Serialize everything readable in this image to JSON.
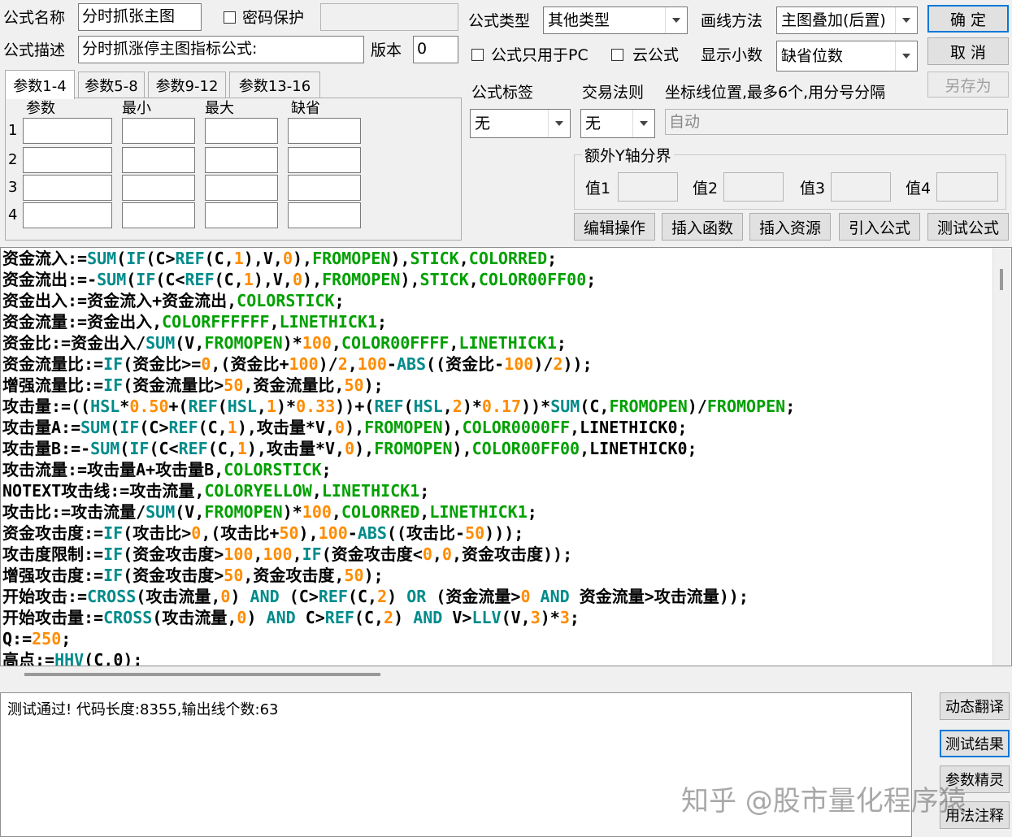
{
  "form": {
    "name_label": "公式名称",
    "name_value": "分时抓张主图",
    "password_label": "密码保护",
    "password_checked": false,
    "desc_label": "公式描述",
    "desc_value": "分时抓涨停主图指标公式:",
    "version_label": "版本",
    "version_value": "0",
    "type_label": "公式类型",
    "type_value": "其他类型",
    "draw_label": "画线方法",
    "draw_value": "主图叠加(后置)",
    "pc_only_label": "公式只用于PC",
    "pc_only_checked": false,
    "cloud_label": "云公式",
    "cloud_checked": false,
    "decimals_label": "显示小数",
    "decimals_value": "缺省位数",
    "tag_label": "公式标签",
    "tag_value": "无",
    "trade_label": "交易法则",
    "trade_value": "无",
    "axis_label": "坐标线位置,最多6个,用分号分隔",
    "axis_value": "自动",
    "yaxis_group_label": "额外Y轴分界",
    "yaxis_values": [
      "值1",
      "值2",
      "值3",
      "值4"
    ]
  },
  "buttons": {
    "ok": "确  定",
    "cancel": "取  消",
    "save_as": "另存为",
    "edit_ops": "编辑操作",
    "insert_func": "插入函数",
    "insert_res": "插入资源",
    "import_formula": "引入公式",
    "test_formula": "测试公式",
    "dyn_translate": "动态翻译",
    "test_result": "测试结果",
    "param_wizard": "参数精灵",
    "usage_notes": "用法注释"
  },
  "param_tabs": [
    "参数1-4",
    "参数5-8",
    "参数9-12",
    "参数13-16"
  ],
  "param_headers": [
    "参数",
    "最小",
    "最大",
    "缺省"
  ],
  "param_rows": [
    "1",
    "2",
    "3",
    "4"
  ],
  "colors": {
    "keyword": "#008b8b",
    "number": "#ff8c00",
    "color_const": "#00a000",
    "plain": "#000000"
  },
  "code_lines": [
    [
      [
        "p",
        "资金流入:="
      ],
      [
        "k",
        "SUM"
      ],
      [
        "p",
        "("
      ],
      [
        "k",
        "IF"
      ],
      [
        "p",
        "(C>"
      ],
      [
        "k",
        "REF"
      ],
      [
        "p",
        "(C,"
      ],
      [
        "n",
        "1"
      ],
      [
        "p",
        "),V,"
      ],
      [
        "n",
        "0"
      ],
      [
        "p",
        "),"
      ],
      [
        "g",
        "FROMOPEN"
      ],
      [
        "p",
        "),"
      ],
      [
        "g",
        "STICK"
      ],
      [
        "p",
        ","
      ],
      [
        "g",
        "COLORRED"
      ],
      [
        "p",
        ";"
      ]
    ],
    [
      [
        "p",
        "资金流出:=-"
      ],
      [
        "k",
        "SUM"
      ],
      [
        "p",
        "("
      ],
      [
        "k",
        "IF"
      ],
      [
        "p",
        "(C<"
      ],
      [
        "k",
        "REF"
      ],
      [
        "p",
        "(C,"
      ],
      [
        "n",
        "1"
      ],
      [
        "p",
        "),V,"
      ],
      [
        "n",
        "0"
      ],
      [
        "p",
        "),"
      ],
      [
        "g",
        "FROMOPEN"
      ],
      [
        "p",
        "),"
      ],
      [
        "g",
        "STICK"
      ],
      [
        "p",
        ","
      ],
      [
        "g",
        "COLOR00FF00"
      ],
      [
        "p",
        ";"
      ]
    ],
    [
      [
        "p",
        "资金出入:=资金流入+资金流出,"
      ],
      [
        "g",
        "COLORSTICK"
      ],
      [
        "p",
        ";"
      ]
    ],
    [
      [
        "p",
        "资金流量:=资金出入,"
      ],
      [
        "g",
        "COLORFFFFFF"
      ],
      [
        "p",
        ","
      ],
      [
        "g",
        "LINETHICK1"
      ],
      [
        "p",
        ";"
      ]
    ],
    [
      [
        "p",
        "资金比:=资金出入/"
      ],
      [
        "k",
        "SUM"
      ],
      [
        "p",
        "(V,"
      ],
      [
        "g",
        "FROMOPEN"
      ],
      [
        "p",
        ")*"
      ],
      [
        "n",
        "100"
      ],
      [
        "p",
        ","
      ],
      [
        "g",
        "COLOR00FFFF"
      ],
      [
        "p",
        ","
      ],
      [
        "g",
        "LINETHICK1"
      ],
      [
        "p",
        ";"
      ]
    ],
    [
      [
        "p",
        "资金流量比:="
      ],
      [
        "k",
        "IF"
      ],
      [
        "p",
        "(资金比>="
      ],
      [
        "n",
        "0"
      ],
      [
        "p",
        ",(资金比+"
      ],
      [
        "n",
        "100"
      ],
      [
        "p",
        ")/"
      ],
      [
        "n",
        "2"
      ],
      [
        "p",
        ","
      ],
      [
        "n",
        "100"
      ],
      [
        "p",
        "-"
      ],
      [
        "k",
        "ABS"
      ],
      [
        "p",
        "((资金比-"
      ],
      [
        "n",
        "100"
      ],
      [
        "p",
        ")/"
      ],
      [
        "n",
        "2"
      ],
      [
        "p",
        "));"
      ]
    ],
    [
      [
        "p",
        "增强流量比:="
      ],
      [
        "k",
        "IF"
      ],
      [
        "p",
        "(资金流量比>"
      ],
      [
        "n",
        "50"
      ],
      [
        "p",
        ",资金流量比,"
      ],
      [
        "n",
        "50"
      ],
      [
        "p",
        ");"
      ]
    ],
    [
      [
        "p",
        "攻击量:=(("
      ],
      [
        "k",
        "HSL"
      ],
      [
        "p",
        "*"
      ],
      [
        "n",
        "0.50"
      ],
      [
        "p",
        "+("
      ],
      [
        "k",
        "REF"
      ],
      [
        "p",
        "("
      ],
      [
        "k",
        "HSL"
      ],
      [
        "p",
        ","
      ],
      [
        "n",
        "1"
      ],
      [
        "p",
        ")*"
      ],
      [
        "n",
        "0.33"
      ],
      [
        "p",
        "))+("
      ],
      [
        "k",
        "REF"
      ],
      [
        "p",
        "("
      ],
      [
        "k",
        "HSL"
      ],
      [
        "p",
        ","
      ],
      [
        "n",
        "2"
      ],
      [
        "p",
        ")*"
      ],
      [
        "n",
        "0.17"
      ],
      [
        "p",
        "))*"
      ],
      [
        "k",
        "SUM"
      ],
      [
        "p",
        "(C,"
      ],
      [
        "g",
        "FROMOPEN"
      ],
      [
        "p",
        ")/"
      ],
      [
        "g",
        "FROMOPEN"
      ],
      [
        "p",
        ";"
      ]
    ],
    [
      [
        "p",
        "攻击量A:="
      ],
      [
        "k",
        "SUM"
      ],
      [
        "p",
        "("
      ],
      [
        "k",
        "IF"
      ],
      [
        "p",
        "(C>"
      ],
      [
        "k",
        "REF"
      ],
      [
        "p",
        "(C,"
      ],
      [
        "n",
        "1"
      ],
      [
        "p",
        "),攻击量*V,"
      ],
      [
        "n",
        "0"
      ],
      [
        "p",
        "),"
      ],
      [
        "g",
        "FROMOPEN"
      ],
      [
        "p",
        "),"
      ],
      [
        "g",
        "COLOR0000FF"
      ],
      [
        "p",
        ",LINETHICK0;"
      ]
    ],
    [
      [
        "p",
        "攻击量B:=-"
      ],
      [
        "k",
        "SUM"
      ],
      [
        "p",
        "("
      ],
      [
        "k",
        "IF"
      ],
      [
        "p",
        "(C<"
      ],
      [
        "k",
        "REF"
      ],
      [
        "p",
        "(C,"
      ],
      [
        "n",
        "1"
      ],
      [
        "p",
        "),攻击量*V,"
      ],
      [
        "n",
        "0"
      ],
      [
        "p",
        "),"
      ],
      [
        "g",
        "FROMOPEN"
      ],
      [
        "p",
        "),"
      ],
      [
        "g",
        "COLOR00FF00"
      ],
      [
        "p",
        ",LINETHICK0;"
      ]
    ],
    [
      [
        "p",
        "攻击流量:=攻击量A+攻击量B,"
      ],
      [
        "g",
        "COLORSTICK"
      ],
      [
        "p",
        ";"
      ]
    ],
    [
      [
        "p",
        "NOTEXT攻击线:=攻击流量,"
      ],
      [
        "g",
        "COLORYELLOW"
      ],
      [
        "p",
        ","
      ],
      [
        "g",
        "LINETHICK1"
      ],
      [
        "p",
        ";"
      ]
    ],
    [
      [
        "p",
        "攻击比:=攻击流量/"
      ],
      [
        "k",
        "SUM"
      ],
      [
        "p",
        "(V,"
      ],
      [
        "g",
        "FROMOPEN"
      ],
      [
        "p",
        ")*"
      ],
      [
        "n",
        "100"
      ],
      [
        "p",
        ","
      ],
      [
        "g",
        "COLORRED"
      ],
      [
        "p",
        ","
      ],
      [
        "g",
        "LINETHICK1"
      ],
      [
        "p",
        ";"
      ]
    ],
    [
      [
        "p",
        "资金攻击度:="
      ],
      [
        "k",
        "IF"
      ],
      [
        "p",
        "(攻击比>"
      ],
      [
        "n",
        "0"
      ],
      [
        "p",
        ",(攻击比+"
      ],
      [
        "n",
        "50"
      ],
      [
        "p",
        "),"
      ],
      [
        "n",
        "100"
      ],
      [
        "p",
        "-"
      ],
      [
        "k",
        "ABS"
      ],
      [
        "p",
        "((攻击比-"
      ],
      [
        "n",
        "50"
      ],
      [
        "p",
        ")));"
      ]
    ],
    [
      [
        "p",
        "攻击度限制:="
      ],
      [
        "k",
        "IF"
      ],
      [
        "p",
        "(资金攻击度>"
      ],
      [
        "n",
        "100"
      ],
      [
        "p",
        ","
      ],
      [
        "n",
        "100"
      ],
      [
        "p",
        ","
      ],
      [
        "k",
        "IF"
      ],
      [
        "p",
        "(资金攻击度<"
      ],
      [
        "n",
        "0"
      ],
      [
        "p",
        ","
      ],
      [
        "n",
        "0"
      ],
      [
        "p",
        ",资金攻击度));"
      ]
    ],
    [
      [
        "p",
        "增强攻击度:="
      ],
      [
        "k",
        "IF"
      ],
      [
        "p",
        "(资金攻击度>"
      ],
      [
        "n",
        "50"
      ],
      [
        "p",
        ",资金攻击度,"
      ],
      [
        "n",
        "50"
      ],
      [
        "p",
        ");"
      ]
    ],
    [
      [
        "p",
        "开始攻击:="
      ],
      [
        "k",
        "CROSS"
      ],
      [
        "p",
        "(攻击流量,"
      ],
      [
        "n",
        "0"
      ],
      [
        "p",
        ") "
      ],
      [
        "k",
        "AND"
      ],
      [
        "p",
        " (C>"
      ],
      [
        "k",
        "REF"
      ],
      [
        "p",
        "(C,"
      ],
      [
        "n",
        "2"
      ],
      [
        "p",
        ") "
      ],
      [
        "k",
        "OR"
      ],
      [
        "p",
        " (资金流量>"
      ],
      [
        "n",
        "0"
      ],
      [
        "p",
        " "
      ],
      [
        "k",
        "AND"
      ],
      [
        "p",
        " 资金流量>攻击流量));"
      ]
    ],
    [
      [
        "p",
        "开始攻击量:="
      ],
      [
        "k",
        "CROSS"
      ],
      [
        "p",
        "(攻击流量,"
      ],
      [
        "n",
        "0"
      ],
      [
        "p",
        ") "
      ],
      [
        "k",
        "AND"
      ],
      [
        "p",
        " C>"
      ],
      [
        "k",
        "REF"
      ],
      [
        "p",
        "(C,"
      ],
      [
        "n",
        "2"
      ],
      [
        "p",
        ") "
      ],
      [
        "k",
        "AND"
      ],
      [
        "p",
        " V>"
      ],
      [
        "k",
        "LLV"
      ],
      [
        "p",
        "(V,"
      ],
      [
        "n",
        "3"
      ],
      [
        "p",
        ")*"
      ],
      [
        "n",
        "3"
      ],
      [
        "p",
        ";"
      ]
    ],
    [
      [
        "p",
        "Q:="
      ],
      [
        "n",
        "250"
      ],
      [
        "p",
        ";"
      ]
    ],
    [
      [
        "p",
        "高点:="
      ],
      [
        "k",
        "HHV"
      ],
      [
        "p",
        "(C,0);"
      ]
    ]
  ],
  "output_text": "测试通过! 代码长度:8355,输出线个数:63",
  "watermark": "知乎 @股市量化程序猿"
}
